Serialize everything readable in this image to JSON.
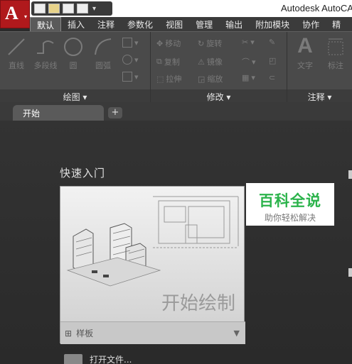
{
  "app": {
    "title": "Autodesk AutoCAD",
    "app_button_label": "A"
  },
  "quick_access": {
    "icons": [
      "new-icon",
      "open-icon",
      "save-icon",
      "plot-icon",
      "more-icon"
    ]
  },
  "ribbon": {
    "tabs": [
      {
        "label": "默认"
      },
      {
        "label": "插入"
      },
      {
        "label": "注释"
      },
      {
        "label": "参数化"
      },
      {
        "label": "视图"
      },
      {
        "label": "管理"
      },
      {
        "label": "输出"
      },
      {
        "label": "附加模块"
      },
      {
        "label": "协作"
      },
      {
        "label": "精"
      }
    ],
    "draw_panel": {
      "title": "绘图 ▾",
      "tools": [
        {
          "label": "直线"
        },
        {
          "label": "多段线"
        },
        {
          "label": "圆"
        },
        {
          "label": "圆弧"
        }
      ]
    },
    "modify_panel": {
      "title": "修改 ▾",
      "tools": [
        {
          "label": "移动"
        },
        {
          "label": "旋转"
        },
        {
          "label": "复制"
        },
        {
          "label": "镜像"
        },
        {
          "label": "拉伸"
        },
        {
          "label": "缩放"
        }
      ]
    },
    "annotation_panel": {
      "title": "注释 ▾",
      "tools": [
        {
          "label": "文字"
        },
        {
          "label": "标注"
        }
      ]
    }
  },
  "documents": {
    "active_tab": "开始",
    "add_label": "+"
  },
  "start_page": {
    "section_title": "快速入门",
    "card_cta": "开始绘制",
    "template_label": "样板",
    "open_files": "打开文件..."
  },
  "watermark": {
    "main": "百科全说",
    "sub": "助你轻松解决"
  }
}
